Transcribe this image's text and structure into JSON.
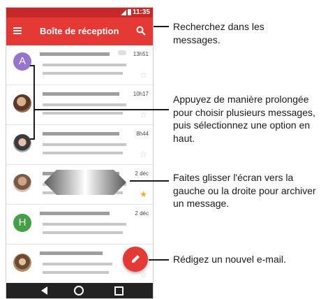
{
  "status_bar": {
    "time": "11:35"
  },
  "app_bar": {
    "title": "Boîte de réception",
    "menu_icon": "hamburger-menu-icon",
    "search_icon": "search-icon"
  },
  "messages": [
    {
      "avatar_letter": "A",
      "avatar_color": "#9575cd",
      "time": "13h51",
      "starred": false
    },
    {
      "avatar_letter": "",
      "avatar_color": "",
      "time": "10h17",
      "starred": false
    },
    {
      "avatar_letter": "",
      "avatar_color": "",
      "time": "8h44",
      "starred": false
    },
    {
      "avatar_letter": "",
      "avatar_color": "",
      "time": "2 déc",
      "starred": true
    },
    {
      "avatar_letter": "H",
      "avatar_color": "#43a047",
      "time": "2 déc",
      "starred": false
    },
    {
      "avatar_letter": "",
      "avatar_color": "",
      "time": "",
      "starred": false
    }
  ],
  "callouts": {
    "search": "Recherchez dans les messages.",
    "select": "Appuyez de manière prolongée pour choisir plusieurs messages, puis sélectionnez une option en haut.",
    "swipe": "Faites glisser l'écran vers la gauche ou la droite pour archiver un message.",
    "compose": "Rédigez un nouvel e-mail."
  },
  "colors": {
    "app_bar": "#e53935",
    "status_bar": "#c62828",
    "star_active": "#f9a825"
  }
}
